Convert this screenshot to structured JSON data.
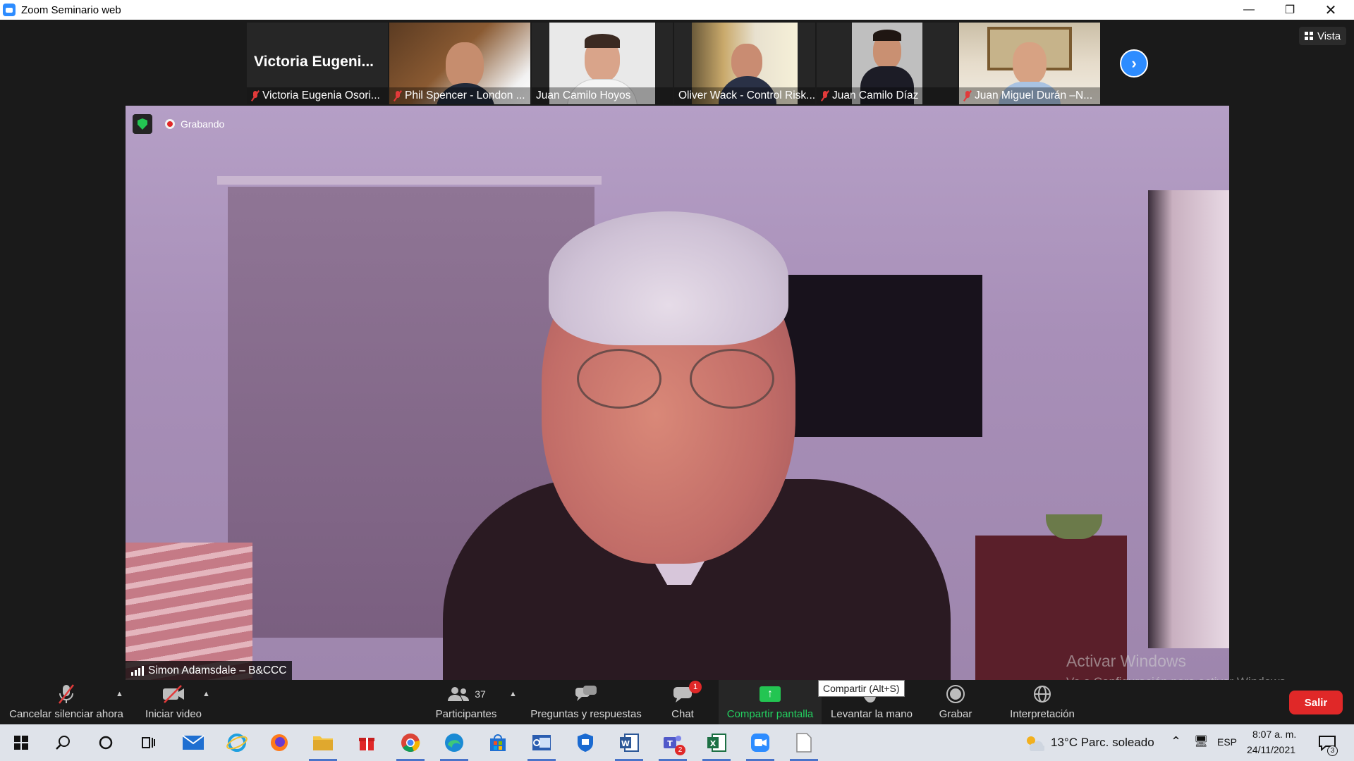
{
  "window": {
    "title": "Zoom Seminario web",
    "controls": [
      "minimize",
      "restore",
      "close"
    ]
  },
  "participants": [
    {
      "name": "Victoria Eugenia Osori...",
      "display_title": "Victoria  Eugeni...",
      "muted": true,
      "has_video": false
    },
    {
      "name": "Phil Spencer - London ...",
      "muted": true,
      "has_video": true
    },
    {
      "name": "Juan Camilo Hoyos",
      "muted": false,
      "has_video": true
    },
    {
      "name": "Oliver Wack - Control Risk...",
      "muted": false,
      "has_video": true
    },
    {
      "name": "Juan Camilo Díaz",
      "muted": true,
      "has_video": true
    },
    {
      "name": "Juan Miguel Durán –N...",
      "muted": true,
      "has_video": true
    }
  ],
  "view_button": "Vista",
  "next_icon": "chevron-right-icon",
  "recording_label": "Grabando",
  "active_speaker": "Simon Adamsdale – B&CCC",
  "watermark": {
    "title": "Activar Windows",
    "subtitle": "Ve a Configuración para activar Windows."
  },
  "toolbar": {
    "unmute": "Cancelar silenciar ahora",
    "video": "Iniciar video",
    "participants": "Participantes",
    "participant_count": "37",
    "qa": "Preguntas y respuestas",
    "chat": "Chat",
    "chat_badge": "1",
    "share": "Compartir pantalla",
    "raise_hand": "Levantar la mano",
    "record": "Grabar",
    "interpretation": "Interpretación",
    "leave": "Salir",
    "share_tooltip": "Compartir (Alt+S)"
  },
  "colors": {
    "accent_blue": "#2d8cff",
    "share_green": "#23c552",
    "leave_red": "#e02828",
    "muted_red": "#e23a3a"
  },
  "taskbar": {
    "apps": [
      "windows-start-icon",
      "search-icon",
      "cortana-icon",
      "task-view-icon",
      "mail-icon",
      "internet-explorer-icon",
      "firefox-icon",
      "file-explorer-icon",
      "gift-icon",
      "chrome-icon",
      "edge-icon",
      "store-icon",
      "outlook-icon",
      "security-icon",
      "word-icon",
      "teams-icon",
      "excel-icon",
      "zoom-icon",
      "notepad-icon"
    ],
    "teams_badge": "2",
    "weather": "13°C  Parc. soleado",
    "language": "ESP",
    "time": "8:07 a. m.",
    "date": "24/11/2021",
    "notifications": "3"
  }
}
